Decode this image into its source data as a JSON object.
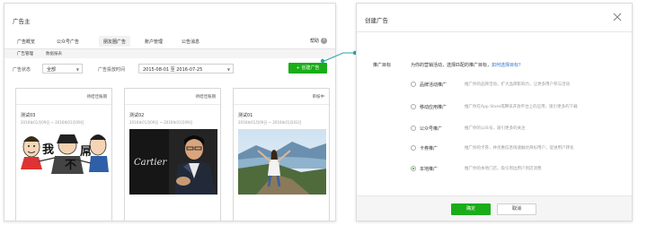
{
  "app": {
    "title": "广告主"
  },
  "nav": {
    "tabs": [
      "广告概览",
      "公众号广告",
      "朋友圈广告",
      "账户管理",
      "公告消息"
    ],
    "help_label": "帮助",
    "help_icon": "question-icon"
  },
  "subnav": {
    "tabs": [
      "广告管理",
      "数据报表"
    ]
  },
  "filters": {
    "status_label": "广告状态",
    "status_value": "全部",
    "time_label": "广告投放时间",
    "time_value": "2015-08-01 至 2016-07-25"
  },
  "create_button": {
    "label": "+ 创建广告"
  },
  "cards": [
    {
      "status": "待结佳账期",
      "name": "测试03",
      "date": "2016年01月09日 ~ 2016年01月09日",
      "image": "comic-faces"
    },
    {
      "status": "待结佳账期",
      "name": "测试02",
      "date": "2016年01月09日 ~ 2016年01月09日",
      "image": "cartier-man",
      "image_text": "Cartier"
    },
    {
      "status": "审核中",
      "name": "测试01",
      "date": "2016年01月09日 ~ 2016年01月02日",
      "image": "mountain-woman"
    }
  ],
  "comic_glyphs": [
    "我",
    "不",
    "屌"
  ],
  "dialog": {
    "title": "创建广告",
    "intro_label": "推广目标",
    "intro_text": "为你的营销活动，选择匹配的推广目标，",
    "intro_link": "如何选择目标？",
    "options": [
      {
        "label": "品牌活动推广",
        "desc": "推广你的品牌活动，扩大品牌影响力，让更多用户参与活动",
        "checked": false
      },
      {
        "label": "移动应用推广",
        "desc": "推广你在App Store或腾讯开放平台上的应用，吸引更多的下载",
        "checked": false
      },
      {
        "label": "公众号推广",
        "desc": "推广你的公众号，吸引更多的关注",
        "checked": false
      },
      {
        "label": "卡券推广",
        "desc": "推广你的卡券，并优惠信息快速触达目标用户，促进用户转化",
        "checked": false
      },
      {
        "label": "本地推广",
        "desc": "推广你的本地门店，吸引周边用户到店消费",
        "checked": true
      }
    ],
    "ok_label": "确定",
    "cancel_label": "取消"
  },
  "colors": {
    "accent": "#1aad19",
    "link": "#2d78c8"
  }
}
